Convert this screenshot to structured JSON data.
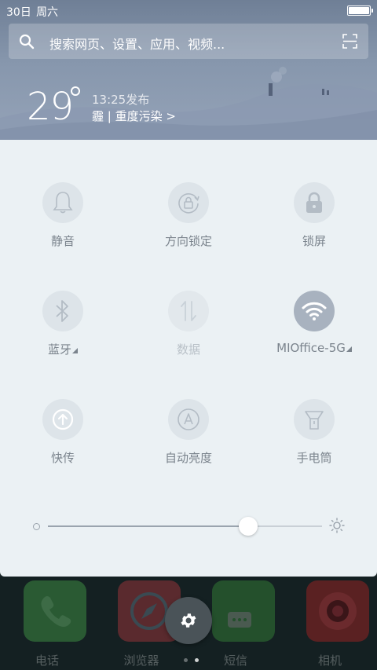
{
  "status_bar": {
    "date": "30日",
    "weekday": "周六"
  },
  "search": {
    "placeholder": "搜索网页、设置、应用、视频..."
  },
  "weather": {
    "temperature": "29",
    "publish_time": "13:25发布",
    "condition": "霾 | 重度污染 >"
  },
  "toggles": [
    {
      "label": "静音",
      "icon": "bell-icon",
      "state": "off"
    },
    {
      "label": "方向锁定",
      "icon": "rotation-lock-icon",
      "state": "off"
    },
    {
      "label": "锁屏",
      "icon": "lock-icon",
      "state": "off"
    },
    {
      "label": "蓝牙",
      "icon": "bluetooth-icon",
      "state": "off"
    },
    {
      "label": "数据",
      "icon": "data-arrows-icon",
      "state": "disabled"
    },
    {
      "label": "MIOffice-5G",
      "icon": "wifi-icon",
      "state": "on"
    },
    {
      "label": "快传",
      "icon": "quick-transfer-icon",
      "state": "off"
    },
    {
      "label": "自动亮度",
      "icon": "auto-brightness-icon",
      "state": "off"
    },
    {
      "label": "手电筒",
      "icon": "flashlight-icon",
      "state": "off"
    }
  ],
  "brightness": {
    "level": 0.73
  },
  "dock": {
    "apps": [
      {
        "label": "电话",
        "icon": "phone-icon",
        "color": "#2a5a33"
      },
      {
        "label": "浏览器",
        "icon": "compass-icon",
        "color": "#5a2a2e"
      },
      {
        "label": "短信",
        "icon": "message-icon",
        "color": "#24502c"
      },
      {
        "label": "相机",
        "icon": "camera-icon",
        "color": "#5a2122"
      }
    ]
  },
  "colors": {
    "panel_bg": "#ebf1f4",
    "tile_off": "#dde4e9",
    "tile_on": "#a8b2bf",
    "label": "#7b848d"
  }
}
